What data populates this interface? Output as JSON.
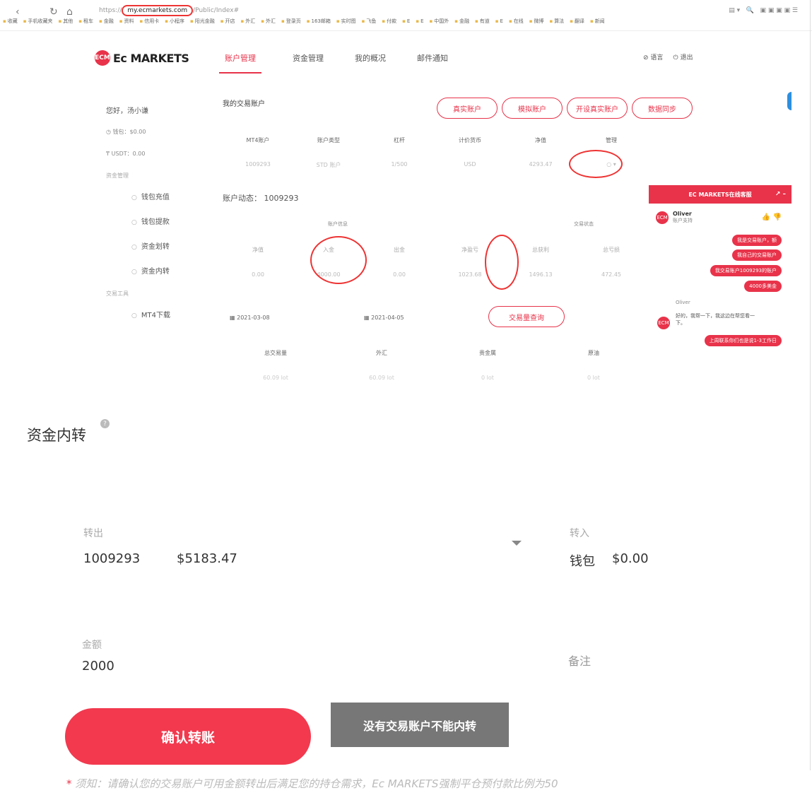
{
  "browser": {
    "url_prefix": "https://",
    "url_host": "my.ecmarkets.com",
    "url_path": "/Public/Index#",
    "bookmarks": [
      "收藏",
      "手机收藏夹",
      "其他",
      "租车",
      "金融",
      "资料",
      "信用卡",
      "小程序",
      "阳光金融",
      "开店",
      "外汇",
      "外汇",
      "登录页",
      "163邮箱",
      "实时图",
      "飞鱼",
      "付款",
      "E",
      "E",
      "中国外",
      "金融",
      "有道",
      "E",
      "在线",
      "微博",
      "算法",
      "翻译",
      "新闻"
    ]
  },
  "header": {
    "brand": "Ec MARKETS",
    "logo_mark": "ECM",
    "nav": [
      "账户管理",
      "资金管理",
      "我的概况",
      "邮件通知"
    ],
    "language": "语言",
    "logout": "退出"
  },
  "sidebar": {
    "greeting": "您好，汤小谦",
    "wallet": "钱包：$0.00",
    "usdt": "USDT：0.00",
    "section_funds": "资金管理",
    "fund_items": [
      "钱包充值",
      "钱包提款",
      "资金划转",
      "资金内转"
    ],
    "section_tools": "交易工具",
    "tool_items": [
      "MT4下载"
    ]
  },
  "accounts": {
    "title": "我的交易账户",
    "buttons": [
      "真实账户",
      "模拟账户",
      "开设真实账户",
      "数据同步"
    ],
    "headers": [
      "MT4账户",
      "账户类型",
      "杠杆",
      "计价货币",
      "净值",
      "管理"
    ],
    "row": [
      "1009293",
      "STD 账户",
      "1/500",
      "USD",
      "4293.47",
      "○ ▾"
    ]
  },
  "dynamics": {
    "title": "账户动态： 1009293",
    "group_info": "账户信息",
    "group_status": "交易状态",
    "headers": [
      "净值",
      "入金",
      "出金",
      "净盈亏",
      "总获利",
      "总亏损"
    ],
    "values": [
      "0.00",
      "4000.00",
      "0.00",
      "1023.68",
      "1496.13",
      "472.45"
    ],
    "date_from": "2021-03-08",
    "date_to": "2021-04-05",
    "query_button": "交易量查询",
    "vol_headers": [
      "总交易量",
      "外汇",
      "贵金属",
      "原油"
    ],
    "vol_values": [
      "60.09 lot",
      "60.09 lot",
      "0 lot",
      "0 lot"
    ]
  },
  "chat": {
    "title": "EC MARKETS在线客服",
    "agent_name": "Oliver",
    "agent_role": "账户支持",
    "user_messages": [
      "我是交易账户，额",
      "我自己的交易账户",
      "我交易账户1009293的账户",
      "4000多美金"
    ],
    "agent_name_2": "Oliver",
    "agent_reply": "好的，我帮一下，我这边在帮您看一下。",
    "user_message_last": "上周联系你们也是说1-3工作日"
  },
  "transfer": {
    "title": "资金内转",
    "from_label": "转出",
    "from_account": "1009293",
    "from_amount": "$5183.47",
    "to_label": "转入",
    "to_account": "钱包",
    "to_amount": "$0.00",
    "amount_label": "金额",
    "amount_value": "2000",
    "note_label": "备注",
    "confirm_button": "确认转账",
    "disabled_button": "没有交易账户不能内转",
    "notice_star": "*",
    "notice": "须知：请确认您的交易账户可用金额转出后满足您的持仓需求，Ec MARKETS强制平仓预付款比例为50"
  },
  "colors": {
    "accent": "#e8334a",
    "disabled": "#777777"
  }
}
